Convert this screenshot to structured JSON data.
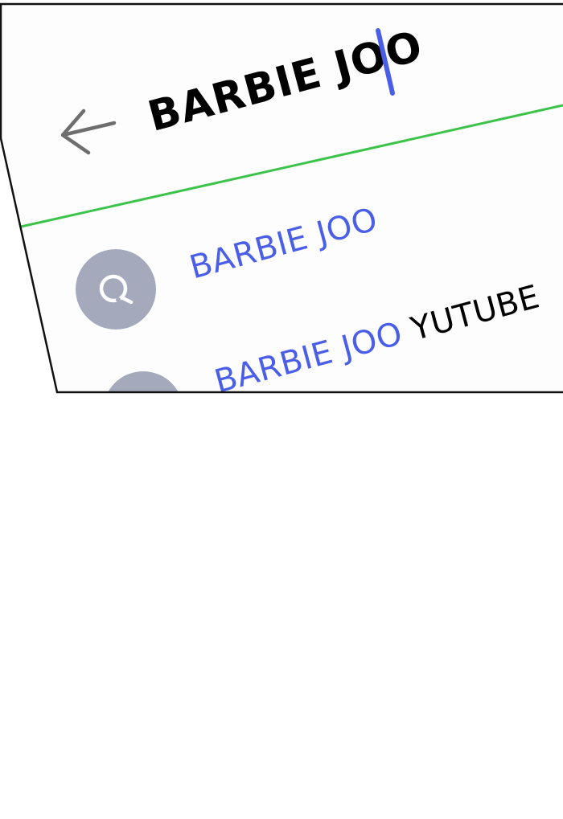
{
  "search": {
    "query": "BARBIE JOO"
  },
  "header": {
    "back_icon": "arrow-left-icon"
  },
  "suggestions": [
    {
      "match": "BARBIE JOO",
      "rest": "",
      "icon": "search-icon"
    },
    {
      "match": "BARBIE JOO",
      "rest": " YUTUBE",
      "icon": "search-icon"
    }
  ],
  "colors": {
    "accent": "#4a5ee8",
    "divider": "#3cc34a",
    "icon_bg": "#a4a9bb",
    "text": "#000000"
  }
}
